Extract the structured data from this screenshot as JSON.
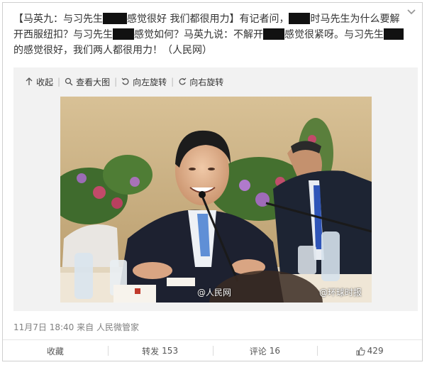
{
  "post": {
    "seg1": "【马英九：与习先生",
    "seg2": "感觉很好 我们都很用力】有记者问，",
    "seg3": "时马先生为什么要解开西服纽扣？与习先生",
    "seg4": "感觉如何？马英九说：不解开",
    "seg5": "感觉很紧呀。与习先生",
    "seg6": "的感觉很好，我们两人都很用力！（人民网）"
  },
  "toolbar": {
    "collapse": "收起",
    "view_large": "查看大图",
    "rotate_left": "向左旋转",
    "rotate_right": "向右旋转"
  },
  "photo": {
    "watermark_left": "@人民网",
    "watermark_right": "@环球时报"
  },
  "meta": {
    "time": "11月7日 18:40",
    "from": "来自 人民微管家"
  },
  "footer": {
    "favorite": "收藏",
    "repost_label": "转发",
    "repost_count": "153",
    "comment_label": "评论",
    "comment_count": "16",
    "like_count": "429"
  },
  "icons": {
    "collapse": "arrow-up-icon",
    "view_large": "magnifier-icon",
    "rotate_left": "rotate-left-icon",
    "rotate_right": "rotate-right-icon",
    "like": "thumbs-up-icon",
    "menu": "chevron-down-icon"
  }
}
